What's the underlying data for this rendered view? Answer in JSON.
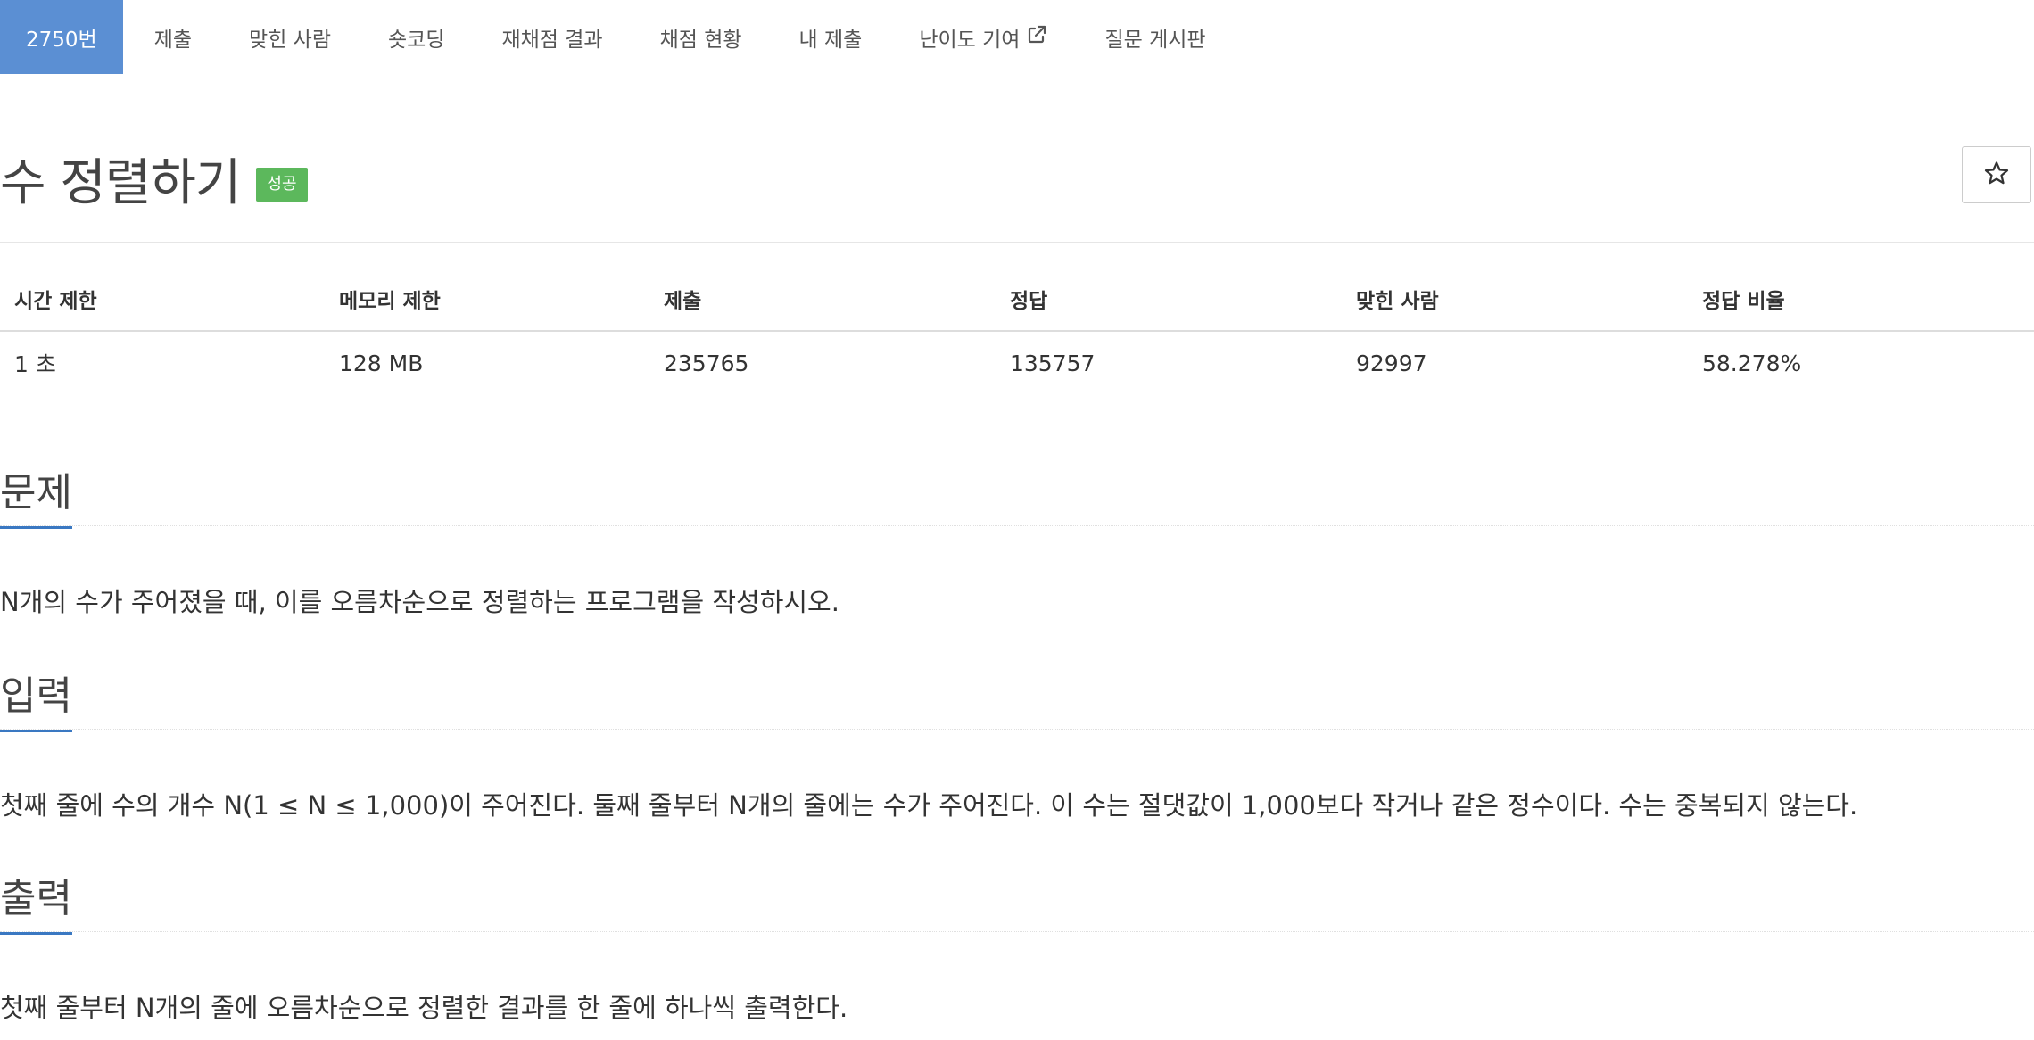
{
  "tabs": [
    {
      "label": "2750번"
    },
    {
      "label": "제출"
    },
    {
      "label": "맞힌 사람"
    },
    {
      "label": "숏코딩"
    },
    {
      "label": "재채점 결과"
    },
    {
      "label": "채점 현황"
    },
    {
      "label": "내 제출"
    },
    {
      "label": "난이도 기여"
    },
    {
      "label": "질문 게시판"
    }
  ],
  "header": {
    "title": "수 정렬하기",
    "badge": "성공",
    "star_icon": "star-outline-icon"
  },
  "info": {
    "headers": [
      "시간 제한",
      "메모리 제한",
      "제출",
      "정답",
      "맞힌 사람",
      "정답 비율"
    ],
    "values": [
      "1 초",
      "128 MB",
      "235765",
      "135757",
      "92997",
      "58.278%"
    ]
  },
  "sections": {
    "problem": {
      "title": "문제",
      "text": "N개의 수가 주어졌을 때, 이를 오름차순으로 정렬하는 프로그램을 작성하시오."
    },
    "input": {
      "title": "입력",
      "text": "첫째 줄에 수의 개수 N(1 ≤ N ≤ 1,000)이 주어진다. 둘째 줄부터 N개의 줄에는 수가 주어진다. 이 수는 절댓값이 1,000보다 작거나 같은 정수이다. 수는 중복되지 않는다."
    },
    "output": {
      "title": "출력",
      "text": "첫째 줄부터 N개의 줄에 오름차순으로 정렬한 결과를 한 줄에 하나씩 출력한다."
    }
  },
  "colors": {
    "active_tab": "#5b8fd3",
    "success_badge": "#5cb85c",
    "section_underline": "#3a78c2"
  }
}
